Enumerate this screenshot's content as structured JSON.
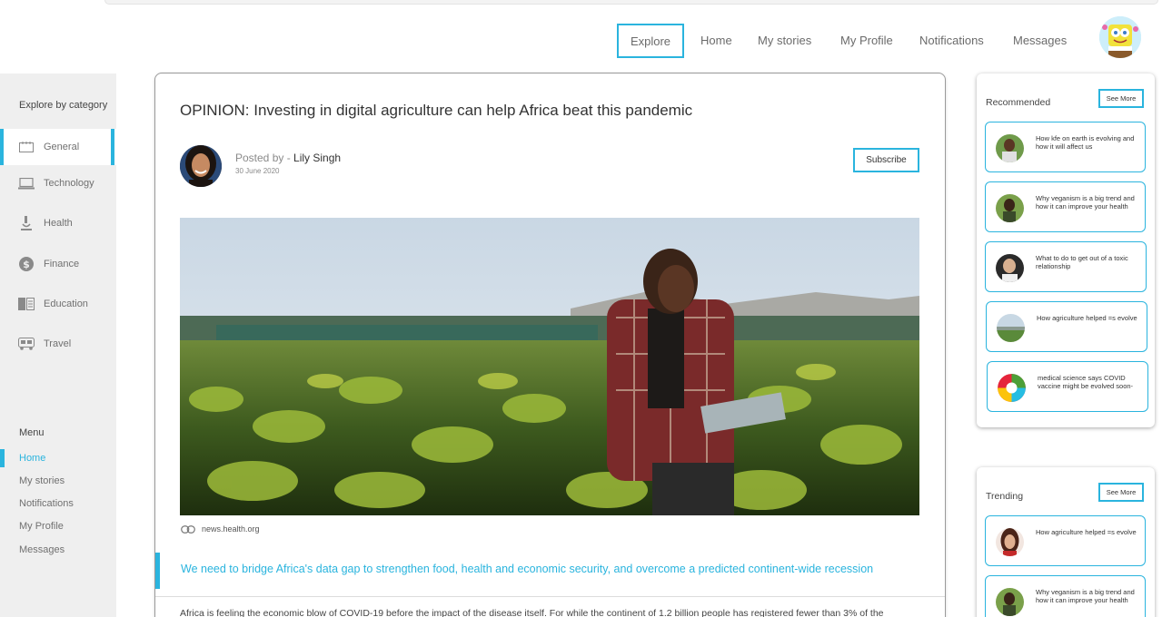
{
  "nav": {
    "explore": "Explore",
    "home": "Home",
    "my_stories": "My stories",
    "my_profile": "My Profile",
    "notifications": "Notifications",
    "messages": "Messages"
  },
  "sidebar": {
    "category_title": "Explore by category",
    "categories": [
      {
        "label": "General",
        "icon": "calendar-icon",
        "active": true
      },
      {
        "label": "Technology",
        "icon": "laptop-icon"
      },
      {
        "label": "Health",
        "icon": "microscope-icon"
      },
      {
        "label": "Finance",
        "icon": "dollar-icon"
      },
      {
        "label": "Education",
        "icon": "book-icon"
      },
      {
        "label": "Travel",
        "icon": "bus-icon"
      }
    ],
    "menu_title": "Menu",
    "menu": [
      {
        "label": "Home",
        "active": true
      },
      {
        "label": "My stories"
      },
      {
        "label": "Notifications"
      },
      {
        "label": "My Profile"
      },
      {
        "label": "Messages"
      }
    ]
  },
  "article": {
    "title": "OPINION: Investing in digital agriculture can help Africa beat this pandemic",
    "posted_by_prefix": "Posted by - ",
    "author": "Lily Singh",
    "date": "30 June 2020",
    "subscribe": "Subscribe",
    "source": "news.health.org",
    "quote": "We need to bridge Africa's data gap to strengthen food, health and economic security, and overcome a predicted continent-wide recession",
    "body": "Africa is feeling the economic blow of COVID-19 before the impact of the disease itself. For while the continent of 1.2 billion people has registered fewer than 3% of the"
  },
  "recommended": {
    "title": "Recommended",
    "see_more": "See More",
    "items": [
      {
        "text": "How kfe on earth is evolving and how it will affect us"
      },
      {
        "text": "Why veganism is a big trend and how it can improve your health"
      },
      {
        "text": "What to do to get out of a toxic relationship"
      },
      {
        "text": "How agriculture helped =s evolve"
      },
      {
        "text": "medical science says COVID vaccine might be evolved soon-"
      }
    ]
  },
  "trending": {
    "title": "Trending",
    "see_more": "See More",
    "items": [
      {
        "text": "How agriculture helped =s evolve"
      },
      {
        "text": "Why veganism is a big trend and how it can improve your health"
      }
    ]
  },
  "colors": {
    "accent": "#2ab4de",
    "sidebar_bg": "#efefef"
  }
}
